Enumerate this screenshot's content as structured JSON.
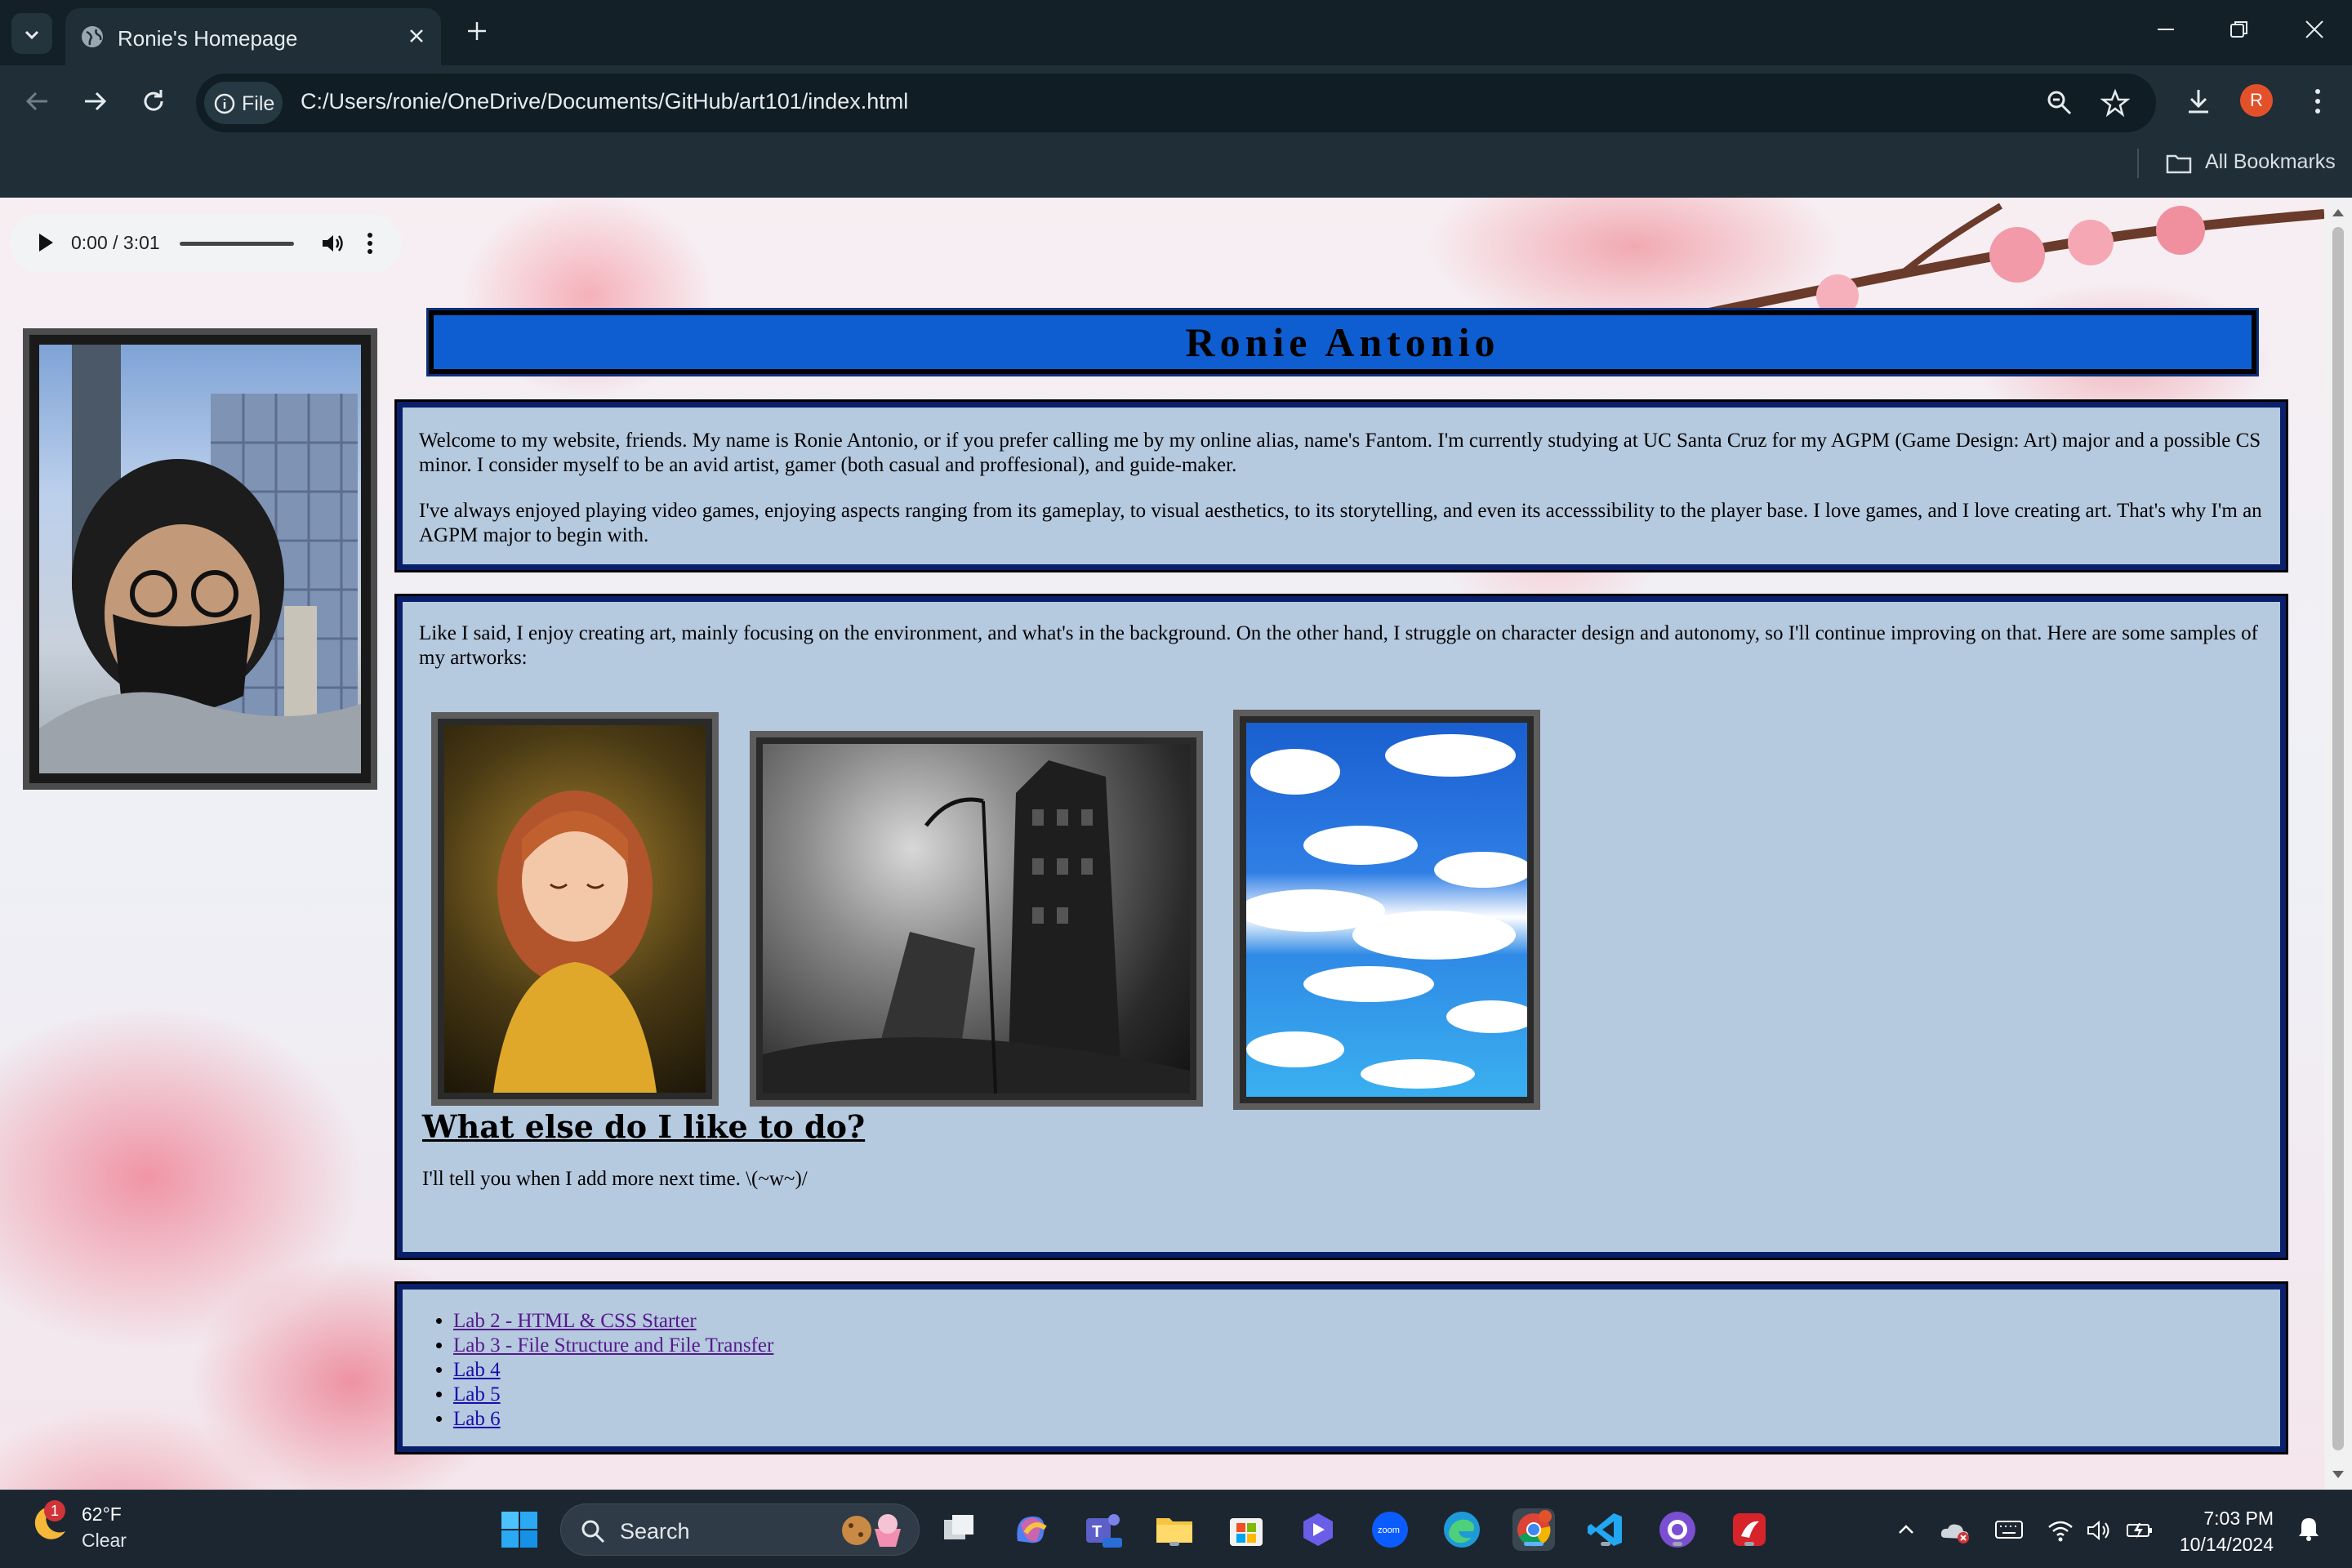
{
  "browser": {
    "tab_title": "Ronie's Homepage",
    "site_chip": "File",
    "url": "C:/Users/ronie/OneDrive/Documents/GitHub/art101/index.html",
    "profile_initial": "R",
    "bookmarks_label": "All Bookmarks"
  },
  "audio": {
    "time": "0:00 / 3:01"
  },
  "page": {
    "heading": "Ronie Antonio",
    "intro_p1": "Welcome to my website, friends. My name is Ronie Antonio, or if you prefer calling me by my online alias, name's Fantom. I'm currently studying at UC Santa Cruz for my AGPM (Game Design: Art) major and a possible CS minor. I consider myself to be an avid artist, gamer (both casual and proffesional), and guide-maker.",
    "intro_p2": "I've always enjoyed playing video games, enjoying aspects ranging from its gameplay, to visual aesthetics, to its storytelling, and even its accesssibility to the player base. I love games, and I love creating art. That's why I'm an AGPM major to begin with.",
    "art_intro": "Like I said, I enjoy creating art, mainly focusing on the environment, and what's in the background. On the other hand, I struggle on character design and autonomy, so I'll continue improving on that. Here are some samples of my artworks:",
    "what_heading": "What else do I like to do?",
    "what_text": "I'll tell you when I add more next time. \\(~w~)/",
    "links": [
      "Lab 2 - HTML & CSS Starter",
      "Lab 3 - File Structure and File Transfer",
      "Lab 4",
      "Lab 5",
      "Lab 6"
    ]
  },
  "taskbar": {
    "weather_temp": "62°F",
    "weather_cond": "Clear",
    "weather_badge": "1",
    "search_placeholder": "Search",
    "time": "7:03 PM",
    "date": "10/14/2024"
  },
  "colors": {
    "heading_bg": "#0f5ed1",
    "panel_bg": "#b5c9df",
    "panel_border": "#0a1f6a",
    "chrome_dark": "#1f2e37"
  }
}
